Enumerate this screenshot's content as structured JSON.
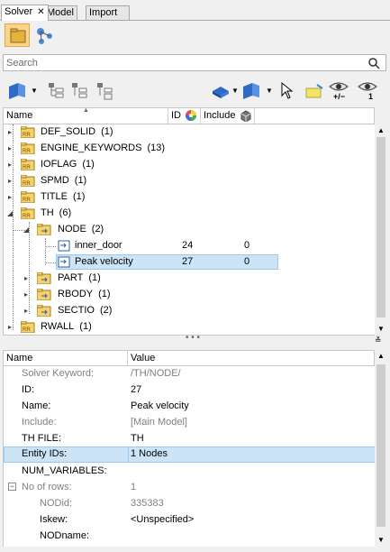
{
  "tabs": [
    {
      "label": "Solver",
      "close": "✕"
    },
    {
      "label": "Model"
    },
    {
      "label": "Import"
    }
  ],
  "search": {
    "placeholder": "Search"
  },
  "tree_header": {
    "name": "Name",
    "id": "ID",
    "include": "Include"
  },
  "tree": {
    "rows": [
      {
        "label": "DEF_SOLID",
        "count": "(1)"
      },
      {
        "label": "ENGINE_KEYWORDS",
        "count": "(13)"
      },
      {
        "label": "IOFLAG",
        "count": "(1)"
      },
      {
        "label": "SPMD",
        "count": "(1)"
      },
      {
        "label": "TITLE",
        "count": "(1)"
      },
      {
        "label": "TH",
        "count": "(6)"
      },
      {
        "label": "NODE",
        "count": "(2)"
      },
      {
        "label": "inner_door",
        "id": "24",
        "include": "0"
      },
      {
        "label": "Peak velocity",
        "id": "27",
        "include": "0"
      },
      {
        "label": "PART",
        "count": "(1)"
      },
      {
        "label": "RBODY",
        "count": "(1)"
      },
      {
        "label": "SECTIO",
        "count": "(2)"
      },
      {
        "label": "RWALL",
        "count": "(1)"
      }
    ]
  },
  "props_header": {
    "name": "Name",
    "value": "Value"
  },
  "props": {
    "rows": [
      {
        "name": "Solver Keyword:",
        "value": "/TH/NODE/"
      },
      {
        "name": "ID:",
        "value": "27"
      },
      {
        "name": "Name:",
        "value": "Peak velocity"
      },
      {
        "name": "Include:",
        "value": "[Main Model]"
      },
      {
        "name": "TH FILE:",
        "value": "TH"
      },
      {
        "name": "Entity IDs:",
        "value": "1 Nodes"
      },
      {
        "name": "NUM_VARIABLES:",
        "value": ""
      },
      {
        "name": "No of rows:",
        "value": "1"
      },
      {
        "name": "NODid:",
        "value": "335383"
      },
      {
        "name": "Iskew:",
        "value": "<Unspecified>"
      },
      {
        "name": "NODname:",
        "value": ""
      }
    ]
  },
  "toolbar": {
    "plusminus_label": "+/−",
    "one_label": "1"
  },
  "colors": {
    "selection": "#cce4f7",
    "folder": "#e3b33c",
    "node_icon": "#2e5fa8"
  }
}
